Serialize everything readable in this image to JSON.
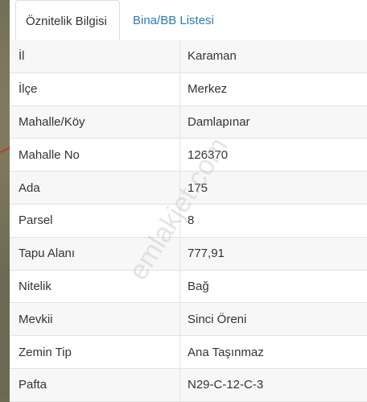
{
  "tabs": [
    {
      "label": "Öznitelik Bilgisi",
      "active": true
    },
    {
      "label": "Bina/BB Listesi",
      "active": false
    }
  ],
  "rows": [
    {
      "key": "İl",
      "value": "Karaman"
    },
    {
      "key": "İlçe",
      "value": "Merkez"
    },
    {
      "key": "Mahalle/Köy",
      "value": "Damlapınar"
    },
    {
      "key": "Mahalle No",
      "value": "126370"
    },
    {
      "key": "Ada",
      "value": "175"
    },
    {
      "key": "Parsel",
      "value": "8"
    },
    {
      "key": "Tapu Alanı",
      "value": "777,91"
    },
    {
      "key": "Nitelik",
      "value": "Bağ"
    },
    {
      "key": "Mevkii",
      "value": "Sinci Öreni"
    },
    {
      "key": "Zemin Tip",
      "value": "Ana Taşınmaz"
    },
    {
      "key": "Pafta",
      "value": "N29-C-12-C-3"
    }
  ],
  "watermark": "emlakjet.com",
  "colors": {
    "tab_link": "#2a7ab8",
    "row_alt": "#f7f7f7",
    "border": "#e2e2e2"
  }
}
